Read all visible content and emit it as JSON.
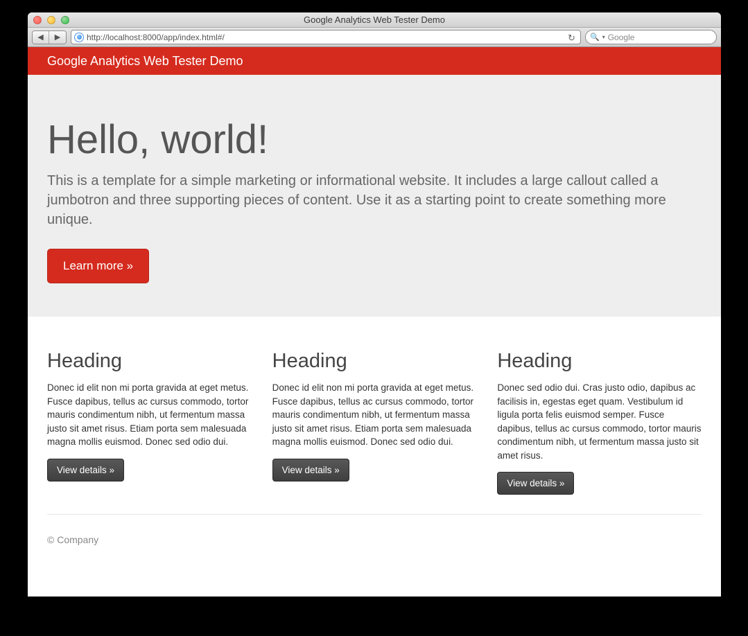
{
  "browser": {
    "window_title": "Google Analytics Web Tester Demo",
    "url": "http://localhost:8000/app/index.html#/",
    "search_placeholder": "Google"
  },
  "navbar": {
    "brand": "Google Analytics Web Tester Demo"
  },
  "jumbotron": {
    "title": "Hello, world!",
    "lead": "This is a template for a simple marketing or informational website. It includes a large callout called a jumbotron and three supporting pieces of content. Use it as a starting point to create something more unique.",
    "cta_label": "Learn more »"
  },
  "columns": [
    {
      "heading": "Heading",
      "text": "Donec id elit non mi porta gravida at eget metus. Fusce dapibus, tellus ac cursus commodo, tortor mauris condimentum nibh, ut fermentum massa justo sit amet risus. Etiam porta sem malesuada magna mollis euismod. Donec sed odio dui.",
      "button_label": "View details »"
    },
    {
      "heading": "Heading",
      "text": "Donec id elit non mi porta gravida at eget metus. Fusce dapibus, tellus ac cursus commodo, tortor mauris condimentum nibh, ut fermentum massa justo sit amet risus. Etiam porta sem malesuada magna mollis euismod. Donec sed odio dui.",
      "button_label": "View details »"
    },
    {
      "heading": "Heading",
      "text": "Donec sed odio dui. Cras justo odio, dapibus ac facilisis in, egestas eget quam. Vestibulum id ligula porta felis euismod semper. Fusce dapibus, tellus ac cursus commodo, tortor mauris condimentum nibh, ut fermentum massa justo sit amet risus.",
      "button_label": "View details »"
    }
  ],
  "footer": {
    "copyright": "© Company"
  },
  "colors": {
    "brand_red": "#d52b1e",
    "jumbotron_bg": "#eeeeee"
  }
}
